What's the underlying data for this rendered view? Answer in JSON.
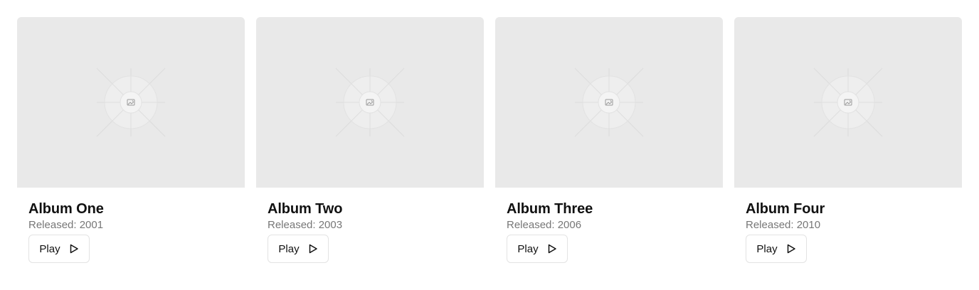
{
  "albums": [
    {
      "title": "Album One",
      "released": "Released: 2001",
      "play_label": "Play",
      "cover_icon": "image-placeholder-icon",
      "play_icon": "play-icon"
    },
    {
      "title": "Album Two",
      "released": "Released: 2003",
      "play_label": "Play",
      "cover_icon": "image-placeholder-icon",
      "play_icon": "play-icon"
    },
    {
      "title": "Album Three",
      "released": "Released: 2006",
      "play_label": "Play",
      "cover_icon": "image-placeholder-icon",
      "play_icon": "play-icon"
    },
    {
      "title": "Album Four",
      "released": "Released: 2010",
      "play_label": "Play",
      "cover_icon": "image-placeholder-icon",
      "play_icon": "play-icon"
    }
  ],
  "colors": {
    "cover_background": "#e9e9e9",
    "title_text": "#111111",
    "subtitle_text": "#777777",
    "button_border": "#e3e3e3"
  }
}
